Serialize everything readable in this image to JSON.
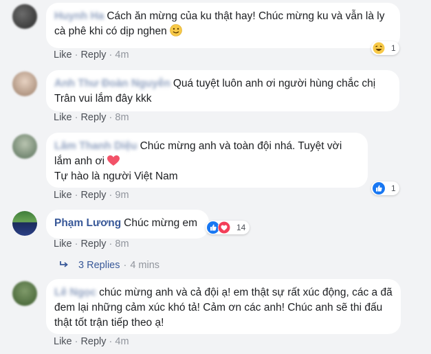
{
  "comments": [
    {
      "author": "Huynh Ha",
      "text": "Cách ăn mừng của ku thật hay! Chúc mừng ku và vẫn là ly cà phê khi có dịp nghen",
      "emoji": "slightly-smiling-face",
      "like_label": "Like",
      "reply_label": "Reply",
      "time": "4m",
      "reaction_icons": [
        "laughing-face"
      ],
      "reaction_count": "1"
    },
    {
      "author": "Anh Thư Đoàn Nguyễn",
      "text": "Quá tuyệt luôn anh ơi người hùng chắc chị Trân vui lắm đây kkk",
      "like_label": "Like",
      "reply_label": "Reply",
      "time": "8m"
    },
    {
      "author": "Lâm Thanh Diệu",
      "text": "Chúc mừng anh và toàn đội nhá. Tuyệt vời lắm anh ơi",
      "emoji": "red-heart",
      "text2": "Tự hào là người Việt Nam",
      "like_label": "Like",
      "reply_label": "Reply",
      "time": "9m",
      "reaction_icons": [
        "like"
      ],
      "reaction_count": "1"
    },
    {
      "author": "Phạm Lương",
      "text": "Chúc mừng em",
      "like_label": "Like",
      "reply_label": "Reply",
      "time": "8m",
      "reaction_icons": [
        "like",
        "love"
      ],
      "reaction_count": "14"
    },
    {
      "author": "Lê Ngọc",
      "text": "chúc mừng anh và cả đội ạ! em thật sự rất xúc động, các a đã đem lại những cảm xúc khó tả! Cảm ơn các anh! Chúc anh sẽ thi đấu thật tốt trận tiếp theo ạ!",
      "like_label": "Like",
      "reply_label": "Reply",
      "time": "4m"
    }
  ],
  "replies": {
    "label": "3 Replies",
    "time": "4 mins",
    "icon": "reply-arrow-icon"
  },
  "separator": "·",
  "colors": {
    "link": "#385898",
    "meta": "#90949c",
    "like_blue": "#1877f2",
    "love_red": "#f33e58",
    "background": "#f2f3f5"
  }
}
